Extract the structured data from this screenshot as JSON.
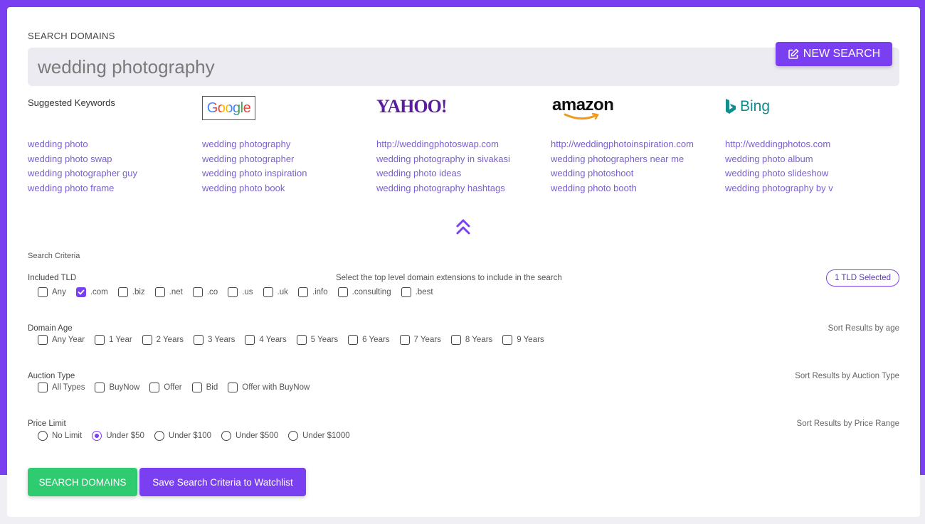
{
  "colors": {
    "accent": "#7b3ff2",
    "success": "#2fcb71",
    "link": "#7b5fd0"
  },
  "search": {
    "label": "SEARCH DOMAINS",
    "value": "wedding photography",
    "new_search_label": "NEW SEARCH"
  },
  "suggested": {
    "title": "Suggested Keywords",
    "logos": {
      "google": "Google",
      "yahoo": "YAHOO!",
      "amazon": "amazon",
      "bing": "Bing"
    },
    "columns": [
      [
        "wedding photo",
        "wedding photo swap",
        "wedding photographer guy",
        "wedding photo frame"
      ],
      [
        "wedding photography",
        "wedding photographer",
        "wedding photo inspiration",
        "wedding photo book"
      ],
      [
        "http://weddingphotoswap.com",
        "wedding photography in sivakasi",
        "wedding photo ideas",
        "wedding photography hashtags"
      ],
      [
        "http://weddingphotoinspiration.com",
        "wedding photographers near me",
        "wedding photoshoot",
        "wedding photo booth"
      ],
      [
        "http://weddingphotos.com",
        "wedding photo album",
        "wedding photo slideshow",
        "wedding photography by v"
      ]
    ],
    "collapse_icon": "double-chevron-up-icon"
  },
  "criteria": {
    "title": "Search Criteria",
    "tld": {
      "label": "Included TLD",
      "hint": "Select the top level domain extensions to include in the search",
      "badge": "1 TLD Selected",
      "options": [
        {
          "label": "Any",
          "checked": false
        },
        {
          "label": ".com",
          "checked": true
        },
        {
          "label": ".biz",
          "checked": false
        },
        {
          "label": ".net",
          "checked": false
        },
        {
          "label": ".co",
          "checked": false
        },
        {
          "label": ".us",
          "checked": false
        },
        {
          "label": ".uk",
          "checked": false
        },
        {
          "label": ".info",
          "checked": false
        },
        {
          "label": ".consulting",
          "checked": false
        },
        {
          "label": ".best",
          "checked": false
        }
      ]
    },
    "age": {
      "label": "Domain Age",
      "sort_note": "Sort Results by age",
      "options": [
        {
          "label": "Any Year",
          "checked": false
        },
        {
          "label": "1 Year",
          "checked": false
        },
        {
          "label": "2 Years",
          "checked": false
        },
        {
          "label": "3 Years",
          "checked": false
        },
        {
          "label": "4 Years",
          "checked": false
        },
        {
          "label": "5 Years",
          "checked": false
        },
        {
          "label": "6 Years",
          "checked": false
        },
        {
          "label": "7 Years",
          "checked": false
        },
        {
          "label": "8 Years",
          "checked": false
        },
        {
          "label": "9 Years",
          "checked": false
        }
      ]
    },
    "auction": {
      "label": "Auction Type",
      "sort_note": "Sort Results by Auction Type",
      "options": [
        {
          "label": "All Types",
          "checked": false
        },
        {
          "label": "BuyNow",
          "checked": false
        },
        {
          "label": "Offer",
          "checked": false
        },
        {
          "label": "Bid",
          "checked": false
        },
        {
          "label": "Offer with BuyNow",
          "checked": false
        }
      ]
    },
    "price": {
      "label": "Price Limit",
      "sort_note": "Sort Results by Price Range",
      "options": [
        {
          "label": "No Limit",
          "checked": false
        },
        {
          "label": "Under $50",
          "checked": true
        },
        {
          "label": "Under $100",
          "checked": false
        },
        {
          "label": "Under $500",
          "checked": false
        },
        {
          "label": "Under $1000",
          "checked": false
        }
      ]
    }
  },
  "actions": {
    "search_label": "SEARCH DOMAINS",
    "watchlist_label": "Save Search Criteria to Watchlist"
  }
}
